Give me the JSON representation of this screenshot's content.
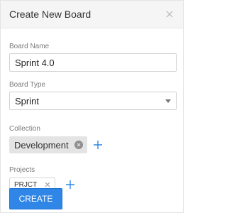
{
  "dialog": {
    "title": "Create New Board"
  },
  "fields": {
    "board_name": {
      "label": "Board Name",
      "value": "Sprint 4.0"
    },
    "board_type": {
      "label": "Board Type",
      "value": "Sprint"
    },
    "collection": {
      "label": "Collection",
      "chips": [
        "Development"
      ]
    },
    "projects": {
      "label": "Projects",
      "chips": [
        "PRJCT"
      ]
    }
  },
  "actions": {
    "create_label": "CREATE"
  },
  "colors": {
    "primary": "#2f86e6",
    "header_bg": "#f5f5f5",
    "chip_bg": "#e4e4e4",
    "add_icon": "#2f86e6"
  },
  "icons": [
    "close-icon",
    "caret-down-icon",
    "remove-chip-icon",
    "plus-icon"
  ]
}
